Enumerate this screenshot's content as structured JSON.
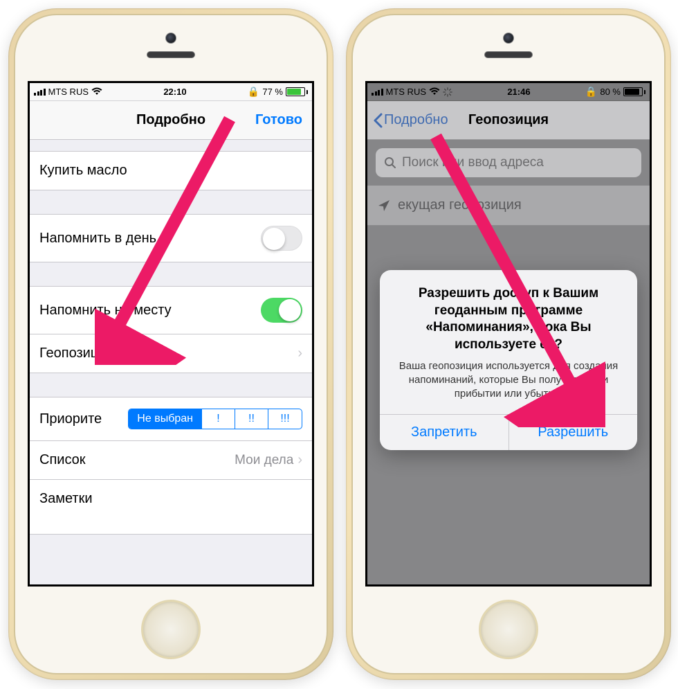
{
  "left": {
    "statusbar": {
      "carrier": "MTS RUS",
      "time": "22:10",
      "battery_pct": "77 %",
      "battery_fill": 77
    },
    "nav": {
      "title": "Подробно",
      "done": "Готово"
    },
    "reminder_title": "Купить масло",
    "rows": {
      "remind_day": "Напомнить в день",
      "remind_place": "Напомнить на месту",
      "geolocation": "Геопозиция",
      "priority": "Приорите",
      "list": "Список",
      "list_value": "Мои дела",
      "notes": "Заметки"
    },
    "priority_seg": [
      "Не выбран",
      "!",
      "!!",
      "!!!"
    ]
  },
  "right": {
    "statusbar": {
      "carrier": "MTS RUS",
      "time": "21:46",
      "battery_pct": "80 %",
      "battery_fill": 80
    },
    "nav": {
      "back": "Подробно",
      "title": "Геопозиция"
    },
    "search_placeholder": "Поиск или ввод адреса",
    "current_location": "екущая геопозиция",
    "alert": {
      "title": "Разрешить доступ к Вашим геоданным программе «Напоминания», пока Вы используете ее?",
      "message": "Ваша геопозиция используется для создания напоминаний, которые Вы получаете при прибытии или убытии.",
      "deny": "Запретить",
      "allow": "Разрешить"
    }
  }
}
